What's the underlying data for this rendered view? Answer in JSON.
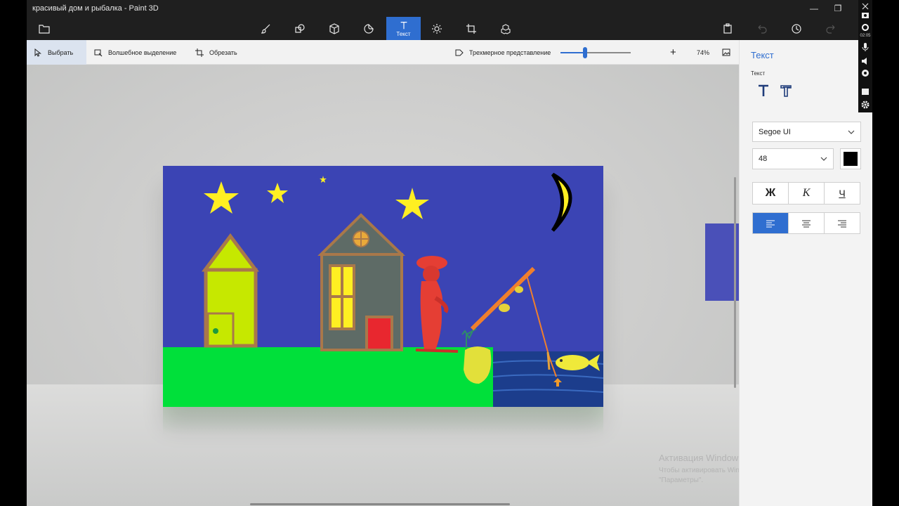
{
  "window": {
    "title": "красивый дом и рыбалка - Paint 3D",
    "buttons": [
      "minimize",
      "restore"
    ]
  },
  "toolbar": {
    "tools": [
      {
        "name": "menu-folder",
        "icon": "folder-icon"
      },
      {
        "name": "brushes",
        "icon": "brush-icon"
      },
      {
        "name": "2d-shapes",
        "icon": "shapes-icon"
      },
      {
        "name": "3d-shapes",
        "icon": "cube-icon"
      },
      {
        "name": "stickers",
        "icon": "sticker-icon"
      },
      {
        "name": "text",
        "icon": "text-icon",
        "label": "Текст",
        "active": true
      },
      {
        "name": "effects",
        "icon": "sun-icon"
      },
      {
        "name": "canvas",
        "icon": "crop-icon"
      },
      {
        "name": "3d-library",
        "icon": "library-icon"
      }
    ],
    "right_icons": [
      "paste-icon",
      "undo-icon",
      "history-icon",
      "redo-icon"
    ]
  },
  "subbar": {
    "select_label": "Выбрать",
    "magic_select_label": "Волшебное выделение",
    "crop_label": "Обрезать",
    "view3d_label": "Трехмерное представление",
    "zoom_minus": "—",
    "zoom_plus": "+",
    "zoom_value": "74%",
    "zoom_level": 0.37
  },
  "panel": {
    "title": "Текст",
    "subtitle": "Текст",
    "font_family": "Segoe UI",
    "font_size": "48",
    "text_color": "#000000",
    "bold": "Ж",
    "italic": "К",
    "underline": "Ч",
    "alignment": "left"
  },
  "watermark": {
    "title": "Активация Windows",
    "body": "Чтобы активировать Windows, перейдите в раздел \"Параметры\"."
  },
  "recorder": {
    "time": "02:05",
    "icons": [
      "camera-icon",
      "record-icon",
      "mic-icon",
      "speaker-icon",
      "webcam-icon",
      "window-icon",
      "settings-icon"
    ]
  },
  "colors": {
    "sky": "#3b44b4",
    "grass": "#00e03a",
    "accent": "#2f6ed0",
    "star": "#ffef22",
    "fisherman": "#e53e34"
  }
}
